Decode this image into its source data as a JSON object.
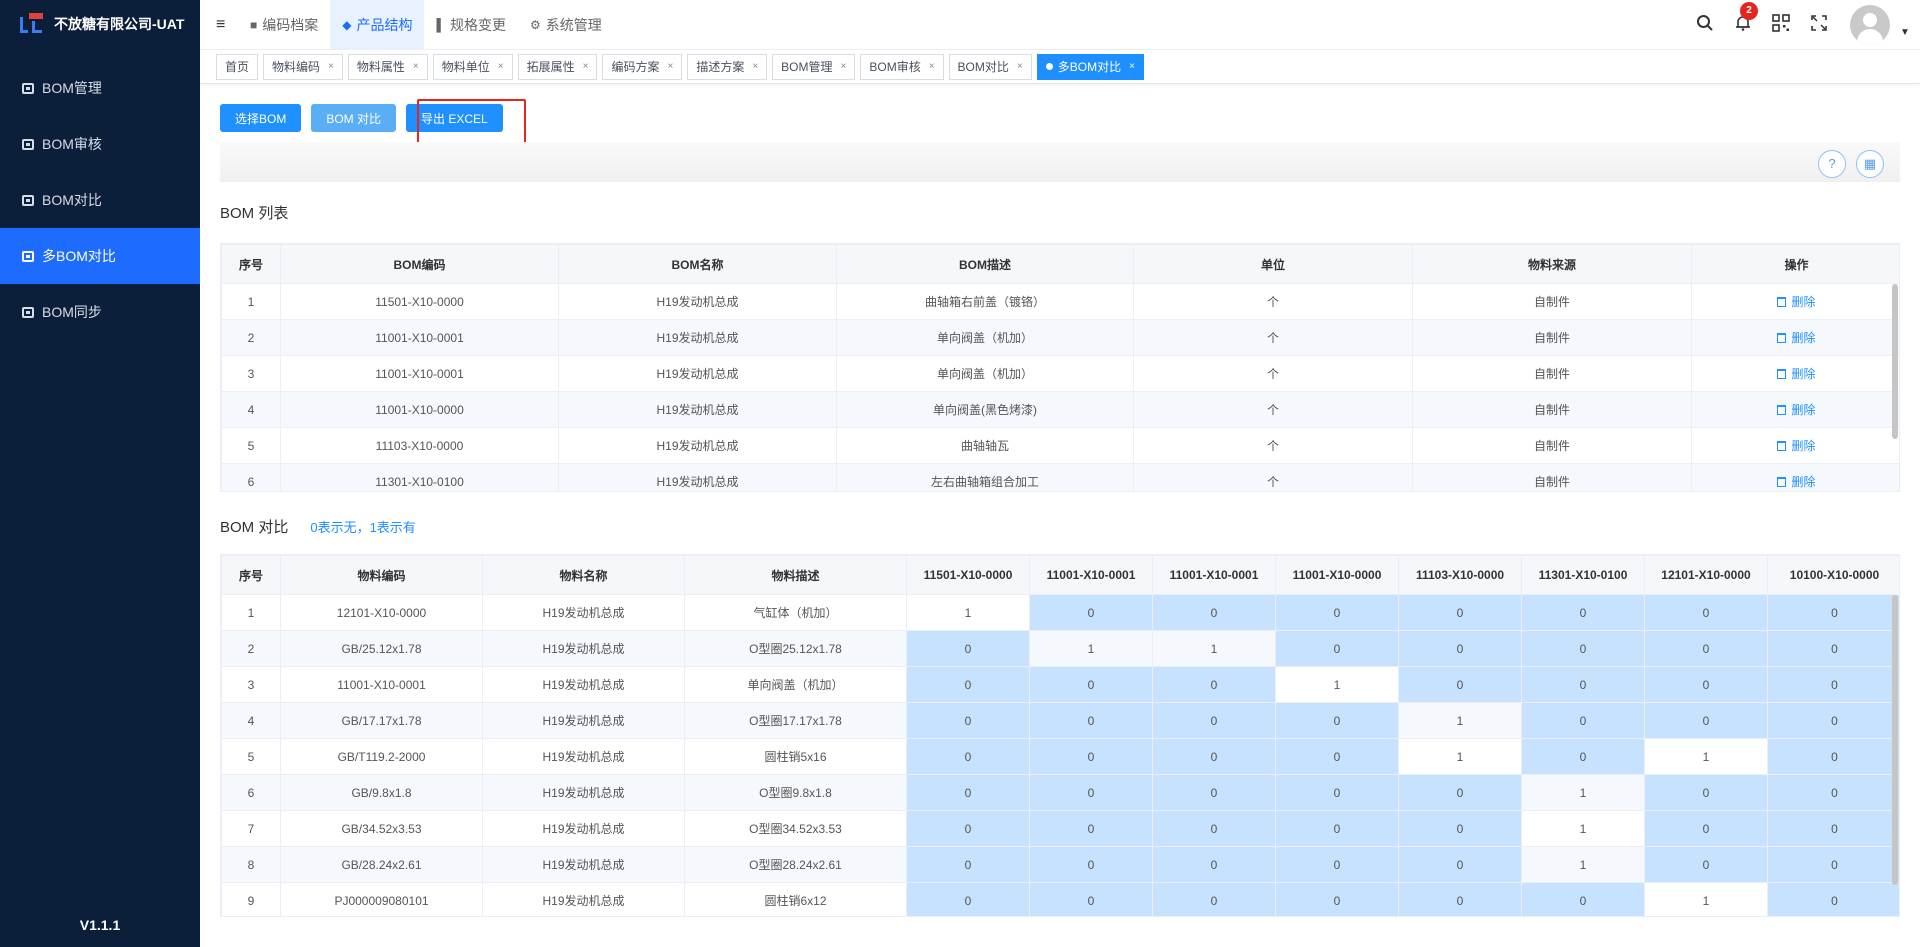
{
  "app": {
    "title": "不放糖有限公司-UAT",
    "version": "V1.1.1"
  },
  "sidebar": {
    "items": [
      {
        "label": "BOM管理",
        "active": false
      },
      {
        "label": "BOM审核",
        "active": false
      },
      {
        "label": "BOM对比",
        "active": false
      },
      {
        "label": "多BOM对比",
        "active": true
      },
      {
        "label": "BOM同步",
        "active": false
      }
    ]
  },
  "topnav": {
    "items": [
      {
        "label": "编码档案",
        "icon": "folder-icon",
        "active": false
      },
      {
        "label": "产品结构",
        "icon": "layers-icon",
        "active": true
      },
      {
        "label": "规格变更",
        "icon": "chart-icon",
        "active": false
      },
      {
        "label": "系统管理",
        "icon": "gear-icon",
        "active": false
      }
    ]
  },
  "header": {
    "notification_count": "2"
  },
  "tags": [
    {
      "label": "首页",
      "closable": false,
      "active": false
    },
    {
      "label": "物料编码",
      "closable": true,
      "active": false
    },
    {
      "label": "物料属性",
      "closable": true,
      "active": false
    },
    {
      "label": "物料单位",
      "closable": true,
      "active": false
    },
    {
      "label": "拓展属性",
      "closable": true,
      "active": false
    },
    {
      "label": "编码方案",
      "closable": true,
      "active": false
    },
    {
      "label": "描述方案",
      "closable": true,
      "active": false
    },
    {
      "label": "BOM管理",
      "closable": true,
      "active": false
    },
    {
      "label": "BOM审核",
      "closable": true,
      "active": false
    },
    {
      "label": "BOM对比",
      "closable": true,
      "active": false
    },
    {
      "label": "多BOM对比",
      "closable": true,
      "active": true
    }
  ],
  "toolbar": {
    "select_bom": "选择BOM",
    "compare_bom": "BOM 对比",
    "export_excel": "导出 EXCEL"
  },
  "bom_list": {
    "title": "BOM 列表",
    "columns": [
      "序号",
      "BOM编码",
      "BOM名称",
      "BOM描述",
      "单位",
      "物料来源",
      "操作"
    ],
    "delete_label": "删除",
    "rows": [
      [
        "1",
        "11501-X10-0000",
        "H19发动机总成",
        "曲轴箱右前盖（镀铬）",
        "个",
        "自制件"
      ],
      [
        "2",
        "11001-X10-0001",
        "H19发动机总成",
        "单向阀盖（机加）",
        "个",
        "自制件"
      ],
      [
        "3",
        "11001-X10-0001",
        "H19发动机总成",
        "单向阀盖（机加）",
        "个",
        "自制件"
      ],
      [
        "4",
        "11001-X10-0000",
        "H19发动机总成",
        "单向阀盖(黑色烤漆)",
        "个",
        "自制件"
      ],
      [
        "5",
        "11103-X10-0000",
        "H19发动机总成",
        "曲轴轴瓦",
        "个",
        "自制件"
      ],
      [
        "6",
        "11301-X10-0100",
        "H19发动机总成",
        "左右曲轴箱组合加工",
        "个",
        "自制件"
      ]
    ]
  },
  "bom_compare": {
    "title": "BOM 对比",
    "hint": "0表示无，1表示有",
    "columns": [
      "序号",
      "物料编码",
      "物料名称",
      "物料描述",
      "11501-X10-0000",
      "11001-X10-0001",
      "11001-X10-0001",
      "11001-X10-0000",
      "11103-X10-0000",
      "11301-X10-0100",
      "12101-X10-0000",
      "10100-X10-0000"
    ],
    "rows": [
      [
        "1",
        "12101-X10-0000",
        "H19发动机总成",
        "气缸体（机加）",
        "1",
        "0",
        "0",
        "0",
        "0",
        "0",
        "0",
        "0"
      ],
      [
        "2",
        "GB/25.12x1.78",
        "H19发动机总成",
        "O型圈25.12x1.78",
        "0",
        "1",
        "1",
        "0",
        "0",
        "0",
        "0",
        "0"
      ],
      [
        "3",
        "11001-X10-0001",
        "H19发动机总成",
        "单向阀盖（机加）",
        "0",
        "0",
        "0",
        "1",
        "0",
        "0",
        "0",
        "0"
      ],
      [
        "4",
        "GB/17.17x1.78",
        "H19发动机总成",
        "O型圈17.17x1.78",
        "0",
        "0",
        "0",
        "0",
        "1",
        "0",
        "0",
        "0"
      ],
      [
        "5",
        "GB/T119.2-2000",
        "H19发动机总成",
        "圆柱销5x16",
        "0",
        "0",
        "0",
        "0",
        "1",
        "0",
        "1",
        "0"
      ],
      [
        "6",
        "GB/9.8x1.8",
        "H19发动机总成",
        "O型圈9.8x1.8",
        "0",
        "0",
        "0",
        "0",
        "0",
        "1",
        "0",
        "0"
      ],
      [
        "7",
        "GB/34.52x3.53",
        "H19发动机总成",
        "O型圈34.52x3.53",
        "0",
        "0",
        "0",
        "0",
        "0",
        "1",
        "0",
        "0"
      ],
      [
        "8",
        "GB/28.24x2.61",
        "H19发动机总成",
        "O型圈28.24x2.61",
        "0",
        "0",
        "0",
        "0",
        "0",
        "1",
        "0",
        "0"
      ],
      [
        "9",
        "PJ000009080101",
        "H19发动机总成",
        "圆柱销6x12",
        "0",
        "0",
        "0",
        "0",
        "0",
        "0",
        "1",
        "0"
      ]
    ]
  },
  "colors": {
    "sidebar_bg": "#0b1f3a",
    "accent": "#1e6bff",
    "zero_cell": "#c6e2ff",
    "highlight": "#e5261f"
  }
}
